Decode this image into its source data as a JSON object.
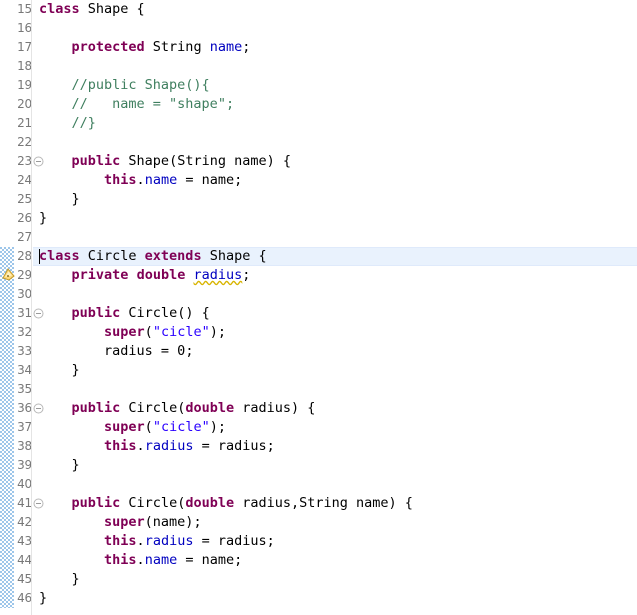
{
  "editor": {
    "language": "Java",
    "first_visible_line": 15,
    "last_visible_line": 46,
    "current_line": 28,
    "line_height_px": 19,
    "colors": {
      "background": "#ffffff",
      "keyword": "#7f0055",
      "string": "#2a00ff",
      "comment": "#3f7f5f",
      "field": "#0000c0",
      "plain": "#000000",
      "line_number": "#787878",
      "current_line_highlight": "#e9f2fd",
      "change_bar": "#9dc6ea",
      "warning_squiggle": "#d8b400"
    },
    "change_bar": {
      "from_line": 28,
      "to_line": 46
    },
    "fold_markers": [
      23,
      31,
      36,
      41
    ],
    "warning_markers": [
      29
    ],
    "lines": [
      {
        "n": 15,
        "tokens": [
          {
            "t": "kw",
            "v": "class"
          },
          {
            "t": "pln",
            "v": " Shape {"
          }
        ]
      },
      {
        "n": 16,
        "tokens": []
      },
      {
        "n": 17,
        "tokens": [
          {
            "t": "pln",
            "v": "    "
          },
          {
            "t": "kw",
            "v": "protected"
          },
          {
            "t": "pln",
            "v": " String "
          },
          {
            "t": "fld",
            "v": "name"
          },
          {
            "t": "pln",
            "v": ";"
          }
        ]
      },
      {
        "n": 18,
        "tokens": []
      },
      {
        "n": 19,
        "tokens": [
          {
            "t": "pln",
            "v": "    "
          },
          {
            "t": "cmt",
            "v": "//public Shape(){"
          }
        ]
      },
      {
        "n": 20,
        "tokens": [
          {
            "t": "pln",
            "v": "    "
          },
          {
            "t": "cmt",
            "v": "//   name = \"shape\";"
          }
        ]
      },
      {
        "n": 21,
        "tokens": [
          {
            "t": "pln",
            "v": "    "
          },
          {
            "t": "cmt",
            "v": "//}"
          }
        ]
      },
      {
        "n": 22,
        "tokens": []
      },
      {
        "n": 23,
        "tokens": [
          {
            "t": "pln",
            "v": "    "
          },
          {
            "t": "kw",
            "v": "public"
          },
          {
            "t": "pln",
            "v": " Shape(String name) {"
          }
        ]
      },
      {
        "n": 24,
        "tokens": [
          {
            "t": "pln",
            "v": "        "
          },
          {
            "t": "kw",
            "v": "this"
          },
          {
            "t": "pln",
            "v": "."
          },
          {
            "t": "fld",
            "v": "name"
          },
          {
            "t": "pln",
            "v": " = name;"
          }
        ]
      },
      {
        "n": 25,
        "tokens": [
          {
            "t": "pln",
            "v": "    }"
          }
        ]
      },
      {
        "n": 26,
        "tokens": [
          {
            "t": "pln",
            "v": "}"
          }
        ]
      },
      {
        "n": 27,
        "tokens": []
      },
      {
        "n": 28,
        "tokens": [
          {
            "t": "kw",
            "v": "class"
          },
          {
            "t": "pln",
            "v": " Circle "
          },
          {
            "t": "kw",
            "v": "extends"
          },
          {
            "t": "pln",
            "v": " Shape {"
          }
        ]
      },
      {
        "n": 29,
        "tokens": [
          {
            "t": "pln",
            "v": "    "
          },
          {
            "t": "kw",
            "v": "private"
          },
          {
            "t": "pln",
            "v": " "
          },
          {
            "t": "kw",
            "v": "double"
          },
          {
            "t": "pln",
            "v": " "
          },
          {
            "t": "fld squiggle",
            "v": "radius"
          },
          {
            "t": "pln",
            "v": ";"
          }
        ]
      },
      {
        "n": 30,
        "tokens": []
      },
      {
        "n": 31,
        "tokens": [
          {
            "t": "pln",
            "v": "    "
          },
          {
            "t": "kw",
            "v": "public"
          },
          {
            "t": "pln",
            "v": " Circle() {"
          }
        ]
      },
      {
        "n": 32,
        "tokens": [
          {
            "t": "pln",
            "v": "        "
          },
          {
            "t": "kw",
            "v": "super"
          },
          {
            "t": "pln",
            "v": "("
          },
          {
            "t": "str",
            "v": "\"cicle\""
          },
          {
            "t": "pln",
            "v": ");"
          }
        ]
      },
      {
        "n": 33,
        "tokens": [
          {
            "t": "pln",
            "v": "        radius = "
          },
          {
            "t": "num",
            "v": "0"
          },
          {
            "t": "pln",
            "v": ";"
          }
        ]
      },
      {
        "n": 34,
        "tokens": [
          {
            "t": "pln",
            "v": "    }"
          }
        ]
      },
      {
        "n": 35,
        "tokens": []
      },
      {
        "n": 36,
        "tokens": [
          {
            "t": "pln",
            "v": "    "
          },
          {
            "t": "kw",
            "v": "public"
          },
          {
            "t": "pln",
            "v": " Circle("
          },
          {
            "t": "kw",
            "v": "double"
          },
          {
            "t": "pln",
            "v": " radius) {"
          }
        ]
      },
      {
        "n": 37,
        "tokens": [
          {
            "t": "pln",
            "v": "        "
          },
          {
            "t": "kw",
            "v": "super"
          },
          {
            "t": "pln",
            "v": "("
          },
          {
            "t": "str",
            "v": "\"cicle\""
          },
          {
            "t": "pln",
            "v": ");"
          }
        ]
      },
      {
        "n": 38,
        "tokens": [
          {
            "t": "pln",
            "v": "        "
          },
          {
            "t": "kw",
            "v": "this"
          },
          {
            "t": "pln",
            "v": "."
          },
          {
            "t": "fld",
            "v": "radius"
          },
          {
            "t": "pln",
            "v": " = radius;"
          }
        ]
      },
      {
        "n": 39,
        "tokens": [
          {
            "t": "pln",
            "v": "    }"
          }
        ]
      },
      {
        "n": 40,
        "tokens": []
      },
      {
        "n": 41,
        "tokens": [
          {
            "t": "pln",
            "v": "    "
          },
          {
            "t": "kw",
            "v": "public"
          },
          {
            "t": "pln",
            "v": " Circle("
          },
          {
            "t": "kw",
            "v": "double"
          },
          {
            "t": "pln",
            "v": " radius,String name) {"
          }
        ]
      },
      {
        "n": 42,
        "tokens": [
          {
            "t": "pln",
            "v": "        "
          },
          {
            "t": "kw",
            "v": "super"
          },
          {
            "t": "pln",
            "v": "(name);"
          }
        ]
      },
      {
        "n": 43,
        "tokens": [
          {
            "t": "pln",
            "v": "        "
          },
          {
            "t": "kw",
            "v": "this"
          },
          {
            "t": "pln",
            "v": "."
          },
          {
            "t": "fld",
            "v": "radius"
          },
          {
            "t": "pln",
            "v": " = radius;"
          }
        ]
      },
      {
        "n": 44,
        "tokens": [
          {
            "t": "pln",
            "v": "        "
          },
          {
            "t": "kw",
            "v": "this"
          },
          {
            "t": "pln",
            "v": "."
          },
          {
            "t": "fld",
            "v": "name"
          },
          {
            "t": "pln",
            "v": " = name;"
          }
        ]
      },
      {
        "n": 45,
        "tokens": [
          {
            "t": "pln",
            "v": "    }"
          }
        ]
      },
      {
        "n": 46,
        "tokens": [
          {
            "t": "pln",
            "v": "}"
          }
        ]
      }
    ]
  }
}
